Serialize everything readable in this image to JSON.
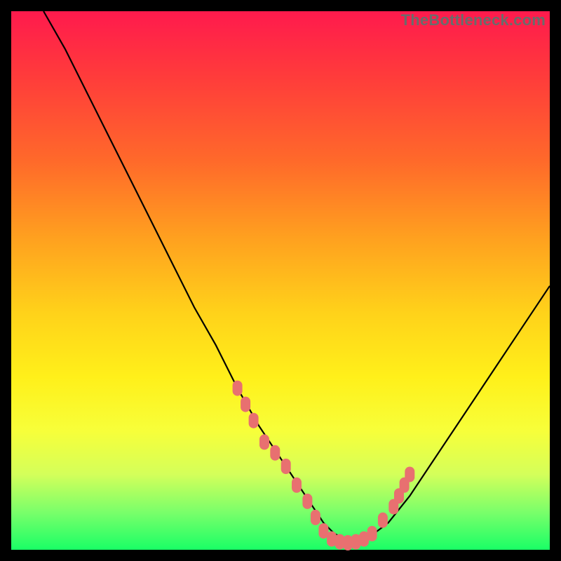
{
  "watermark": "TheBottleneck.com",
  "chart_data": {
    "type": "line",
    "title": "",
    "xlabel": "",
    "ylabel": "",
    "xlim": [
      0,
      100
    ],
    "ylim": [
      0,
      100
    ],
    "grid": false,
    "series": [
      {
        "name": "bottleneck-curve",
        "x": [
          6,
          10,
          14,
          18,
          22,
          26,
          30,
          34,
          38,
          42,
          46,
          50,
          54,
          56,
          58,
          60,
          62,
          64,
          66,
          70,
          74,
          78,
          82,
          86,
          90,
          94,
          100
        ],
        "values": [
          100,
          93,
          85,
          77,
          69,
          61,
          53,
          45,
          38,
          30,
          23,
          17,
          11,
          8,
          5,
          3,
          2,
          1.5,
          2,
          5,
          10,
          16,
          22,
          28,
          34,
          40,
          49
        ]
      }
    ],
    "markers": {
      "name": "highlight-points",
      "x": [
        42,
        43.5,
        45,
        47,
        49,
        51,
        53,
        55,
        56.5,
        58,
        59.5,
        61,
        62.5,
        64,
        65.5,
        67,
        69,
        71,
        72,
        73,
        74
      ],
      "values": [
        30,
        27,
        24,
        20,
        18,
        15.5,
        12,
        9,
        6,
        3.5,
        2,
        1.5,
        1.3,
        1.5,
        2,
        3,
        5.5,
        8,
        10,
        12,
        14
      ]
    },
    "background_gradient": {
      "top": "#ff1a4d",
      "bottom": "#1aff66"
    }
  }
}
